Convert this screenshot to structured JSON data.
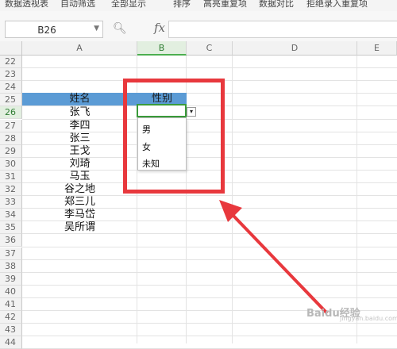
{
  "ribbon": {
    "items": [
      "数据透视表",
      "自动筛选",
      "全部显示",
      "排序",
      "高亮重复项",
      "数据对比",
      "拒绝录入重复项"
    ]
  },
  "formula_bar": {
    "name_box": "B26",
    "fx_label": "fx",
    "formula_value": ""
  },
  "columns": [
    {
      "label": "A",
      "selected": false
    },
    {
      "label": "B",
      "selected": true
    },
    {
      "label": "C",
      "selected": false
    },
    {
      "label": "D",
      "selected": false
    },
    {
      "label": "E",
      "selected": false
    }
  ],
  "rows": [
    "22",
    "23",
    "24",
    "25",
    "26",
    "27",
    "28",
    "29",
    "30",
    "31",
    "32",
    "33",
    "34",
    "35",
    "36",
    "37",
    "38",
    "39",
    "40",
    "41",
    "42",
    "43",
    "44"
  ],
  "selected_row": "26",
  "table": {
    "header_name": "姓名",
    "header_gender": "性别",
    "header_color": "#5b9bd5",
    "names": [
      "张飞",
      "李四",
      "张三",
      "王戈",
      "刘琦",
      "马玉",
      "谷之地",
      "郑三儿",
      "李马岱",
      "吴所谓"
    ]
  },
  "dropdown": {
    "arrow": "▾",
    "options": [
      "男",
      "女",
      "未知"
    ]
  },
  "annotation": {
    "box_color": "#e8383d",
    "arrow_color": "#e8383d"
  },
  "watermark": {
    "text": "Baidu经验",
    "sub": "jingyan.baidu.com"
  }
}
